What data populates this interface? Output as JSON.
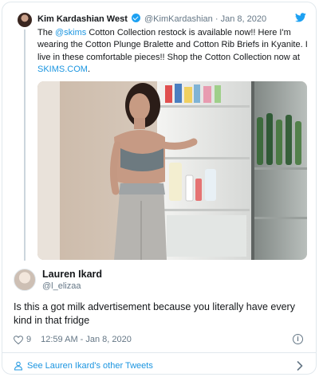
{
  "parent_tweet": {
    "author_name": "Kim Kardashian West",
    "handle": "@KimKardashian",
    "separator": "·",
    "date": "Jan 8, 2020",
    "text_before_mention": "The ",
    "mention": "@skims",
    "text_middle": " Cotton Collection restock is available now!! Here I'm wearing the Cotton Plunge Bralette and Cotton Rib Briefs in Kyanite. I live in these comfortable pieces!! Shop the Cotton Collection now at ",
    "link": "SKIMS.COM",
    "text_end": "."
  },
  "reply": {
    "author_name": "Lauren Ikard",
    "handle": "@l_elizaa",
    "text": "Is this a got milk advertisement because you literally have every kind in that fridge",
    "likes": "9",
    "timestamp": "12:59 AM - Jan 8, 2020"
  },
  "footer": {
    "link_label": "See Lauren Ikard's other Tweets"
  },
  "colors": {
    "link": "#1b95e0",
    "twitter_blue": "#1da1f2",
    "meta_gray": "#657786",
    "border": "#e1e8ed"
  },
  "icons": [
    "verified-badge-icon",
    "twitter-bird-icon",
    "heart-icon",
    "info-icon",
    "person-icon",
    "chevron-right-icon"
  ]
}
